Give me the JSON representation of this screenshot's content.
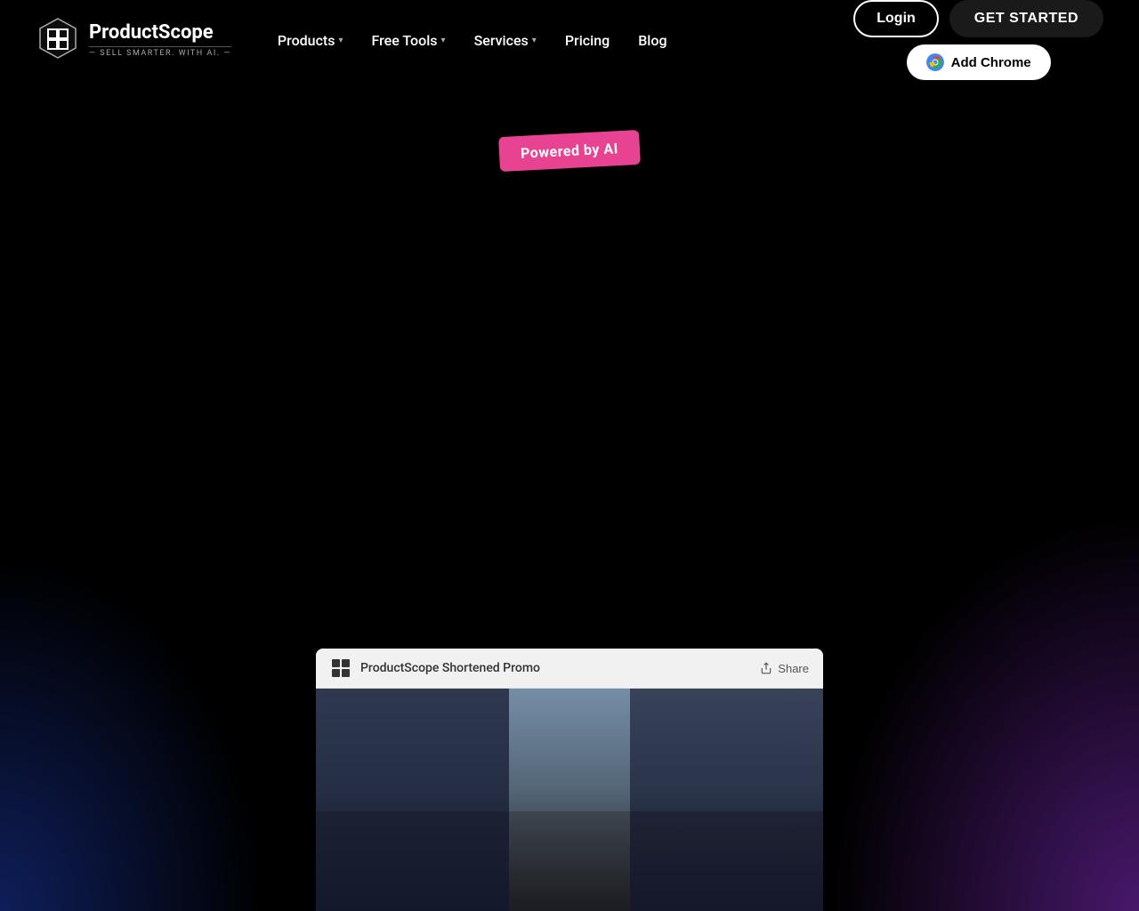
{
  "brand": {
    "name": "ProductScope",
    "tagline": "— SELL SMARTER. WITH AI. —"
  },
  "nav": {
    "products_label": "Products",
    "free_tools_label": "Free Tools",
    "services_label": "Services",
    "pricing_label": "Pricing",
    "blog_label": "Blog"
  },
  "buttons": {
    "login": "Login",
    "get_started": "GET STARTED",
    "add_chrome": "Add Chrome"
  },
  "hero": {
    "powered_badge": "Powered by AI"
  },
  "video": {
    "title": "ProductScope Shortened Promo",
    "share_label": "Share"
  },
  "colors": {
    "background": "#000000",
    "accent_pink": "#e84393",
    "nav_text": "#ffffff",
    "btn_login_border": "#ffffff"
  }
}
